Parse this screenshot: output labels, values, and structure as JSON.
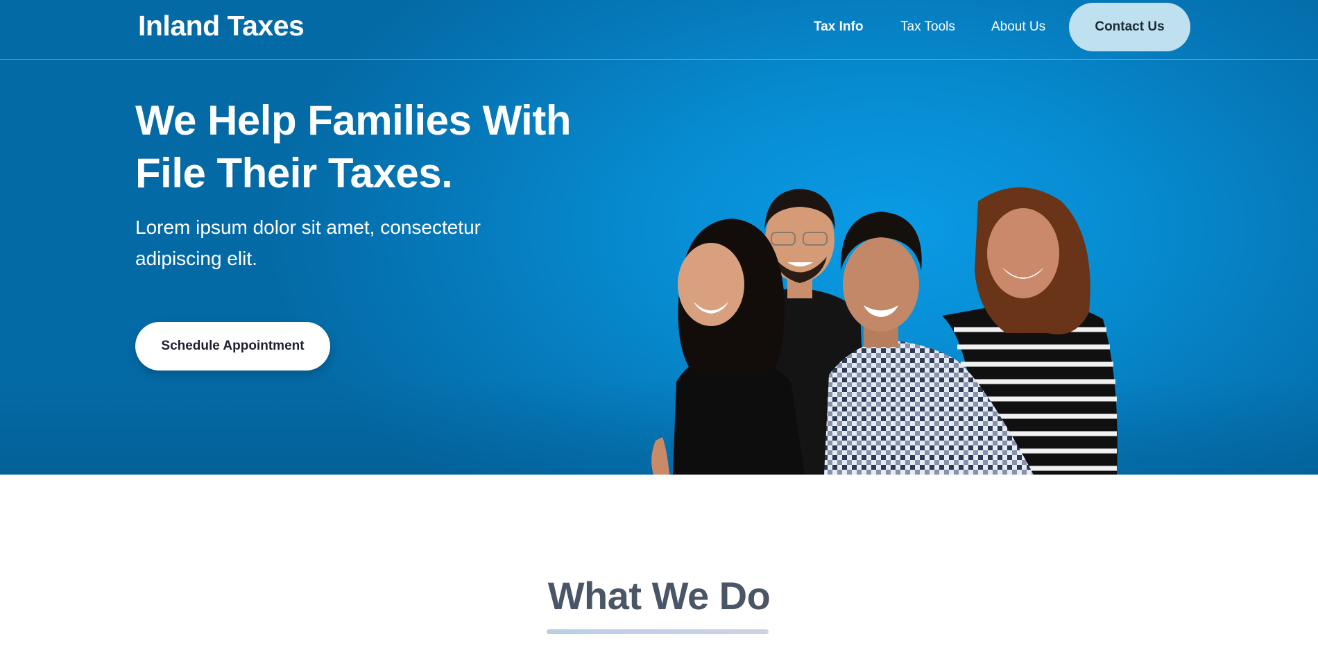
{
  "nav": {
    "brand": "Inland Taxes",
    "links": [
      {
        "label": "Tax Info",
        "active": true
      },
      {
        "label": "Tax Tools",
        "active": false
      },
      {
        "label": "About Us",
        "active": false
      }
    ],
    "contact_label": "Contact Us"
  },
  "hero": {
    "title_line1": "We Help Families With",
    "title_line2": "File Their Taxes.",
    "subtitle_line1": "Lorem ipsum dolor sit amet, consectetur",
    "subtitle_line2": "adipiscing elit.",
    "cta_label": "Schedule Appointment"
  },
  "section": {
    "title": "What We Do"
  },
  "colors": {
    "hero_bg": "#0580c2",
    "contact_bg": "#bfe0ee",
    "heading_gray": "#4a5568",
    "underline": "#c4d2e6"
  }
}
